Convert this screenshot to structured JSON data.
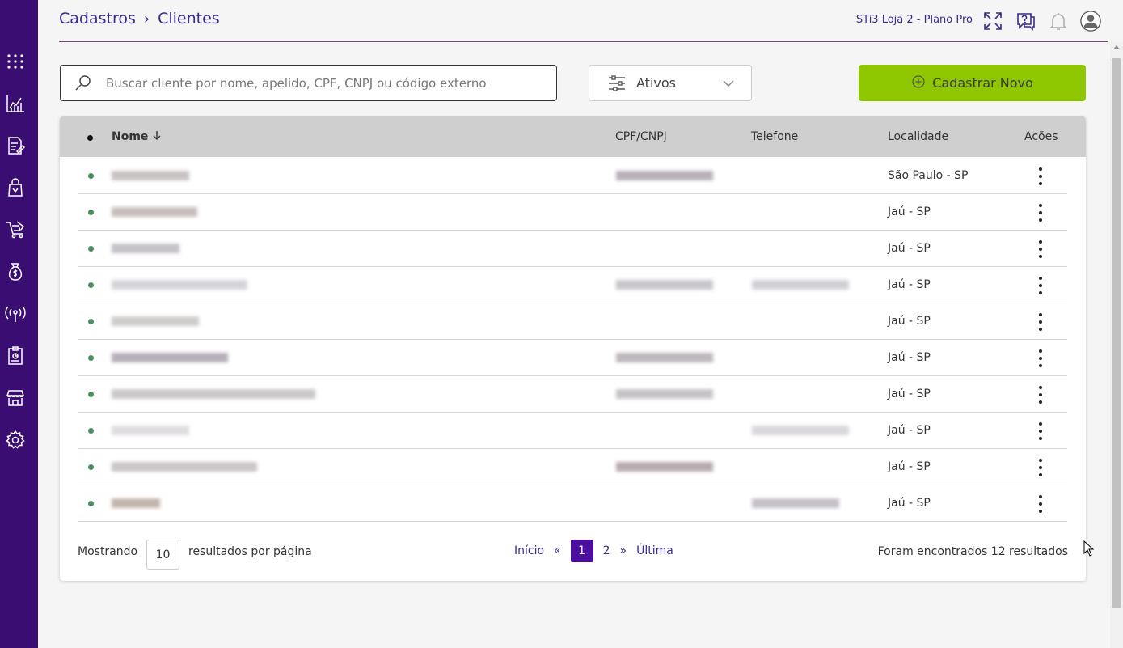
{
  "header": {
    "breadcrumb": [
      "Cadastros",
      "Clientes"
    ],
    "store": "STi3 Loja 2 - Plano Pro"
  },
  "sidebar": {
    "icons": [
      "apps-grid-icon",
      "chart-icon",
      "document-edit-icon",
      "shopping-bag-icon",
      "cart-icon",
      "money-bag-icon",
      "broadcast-icon",
      "report-icon",
      "store-icon",
      "gear-icon"
    ]
  },
  "search": {
    "placeholder": "Buscar cliente por nome, apelido, CPF, CNPJ ou código externo"
  },
  "filter": {
    "label": "Ativos"
  },
  "actions": {
    "new_label": "Cadastrar Novo"
  },
  "table": {
    "columns": {
      "status": "",
      "name": "Nome",
      "cpf": "CPF/CNPJ",
      "phone": "Telefone",
      "location": "Localidade",
      "actions": "Ações"
    },
    "rows": [
      {
        "location": "São Paulo - SP"
      },
      {
        "location": "Jaú - SP"
      },
      {
        "location": "Jaú - SP"
      },
      {
        "location": "Jaú - SP"
      },
      {
        "location": "Jaú - SP"
      },
      {
        "location": "Jaú - SP"
      },
      {
        "location": "Jaú - SP"
      },
      {
        "location": "Jaú - SP"
      },
      {
        "location": "Jaú - SP"
      },
      {
        "location": "Jaú - SP"
      }
    ]
  },
  "pagination": {
    "showing_label": "Mostrando",
    "per_page": "10",
    "per_page_label": "resultados por página",
    "first": "Início",
    "prev": "«",
    "pages": [
      "1",
      "2"
    ],
    "next": "»",
    "last": "Última",
    "found": "Foram encontrados 12 resultados"
  },
  "colors": {
    "sidebar": "#3a0d72",
    "primary_text": "#3a2a8a",
    "accent_button": "#8ec600",
    "active_page": "#4b0fa0",
    "status_dot": "#4c8f5e"
  }
}
